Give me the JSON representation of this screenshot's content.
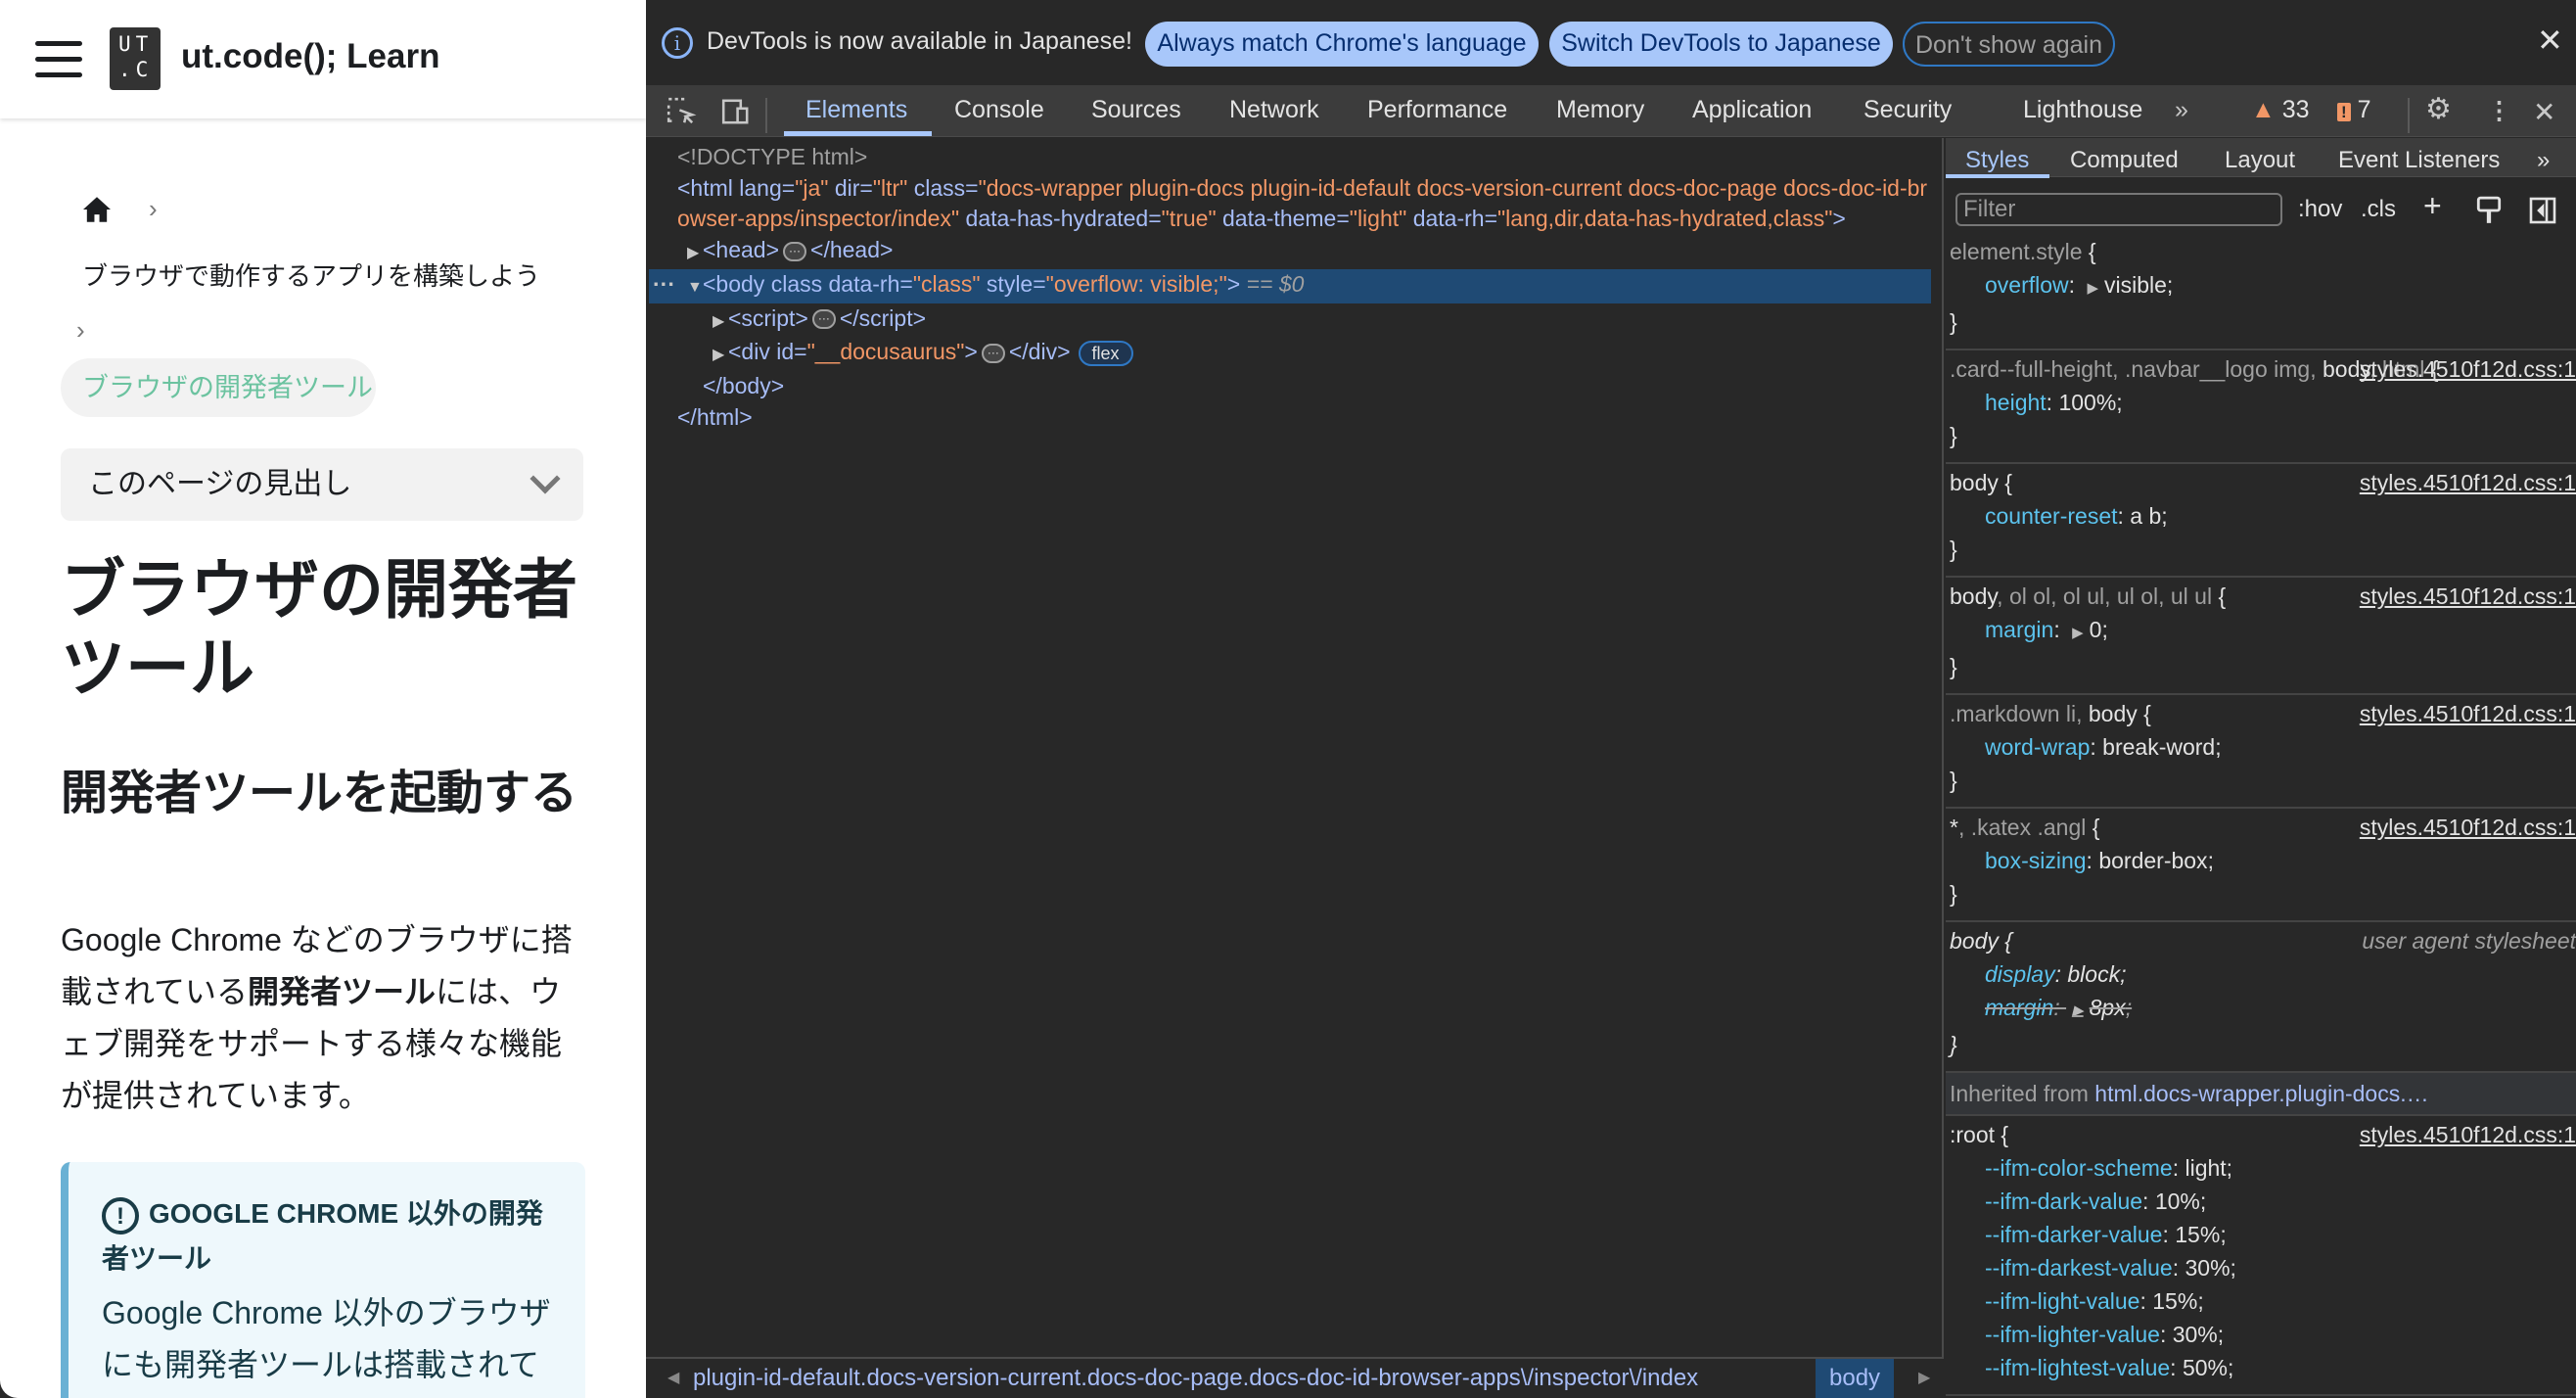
{
  "page": {
    "site_title": "ut.code(); Learn",
    "logo_text": "UT.C",
    "breadcrumb_parent": "ブラウザで動作するアプリを構築しよう",
    "breadcrumb_current": "ブラウザの開発者ツール",
    "toc_label": "このページの見出し",
    "h1": "ブラウザの開発者ツール",
    "h2": "開発者ツールを起動する",
    "para_before": "Google Chrome などのブラウザに搭載されている",
    "para_bold": "開発者ツール",
    "para_after": "には、ウェブ開発をサポートする様々な機能が提供されています。",
    "admonition_title": "GOOGLE CHROME 以外の開発者ツール",
    "admonition_body": "Google Chrome 以外のブラウザにも開発者ツールは搭載されて"
  },
  "infobar": {
    "message": "DevTools is now available in Japanese!",
    "btn_match": "Always match Chrome's language",
    "btn_switch": "Switch DevTools to Japanese",
    "btn_dismiss": "Don't show again"
  },
  "tabs": [
    "Elements",
    "Console",
    "Sources",
    "Network",
    "Performance",
    "Memory",
    "Application",
    "Security",
    "Lighthouse"
  ],
  "active_tab": "Elements",
  "counts": {
    "warnings": "33",
    "issues": "7"
  },
  "elements_tree": [
    {
      "depth": 0,
      "tokens": [
        [
          "doc",
          "<!DOCTYPE html>"
        ]
      ]
    },
    {
      "depth": 0,
      "tokens": [
        [
          "tag",
          "<html "
        ],
        [
          "attr",
          "lang="
        ],
        [
          "val",
          "\"ja\""
        ],
        [
          "attr",
          " dir="
        ],
        [
          "val",
          "\"ltr\""
        ],
        [
          "attr",
          " class="
        ],
        [
          "val",
          "\"docs-wrapper plugin-docs plugin-id-default docs-version-current docs-doc-page docs-doc-id-browser-apps/inspector/index\""
        ],
        [
          "attr",
          " data-has-hydrated="
        ],
        [
          "val",
          "\"true\""
        ],
        [
          "attr",
          " data-theme="
        ],
        [
          "val",
          "\"light\""
        ],
        [
          "attr",
          " data-rh="
        ],
        [
          "val",
          "\"lang,dir,data-has-hydrated,class\""
        ],
        [
          "tag",
          ">"
        ]
      ]
    },
    {
      "depth": 1,
      "arrow": "right",
      "tokens": [
        [
          "tag",
          "<head>"
        ],
        [
          "ell",
          ""
        ],
        [
          "tag",
          "</head>"
        ]
      ]
    },
    {
      "depth": 1,
      "arrow": "down",
      "selected": true,
      "tokens": [
        [
          "tag",
          "<body "
        ],
        [
          "attr",
          "class data-rh="
        ],
        [
          "val",
          "\"class\""
        ],
        [
          "attr",
          " style="
        ],
        [
          "val",
          "\"overflow: visible;\""
        ],
        [
          "tag",
          ">"
        ],
        [
          "dim",
          " == $0"
        ]
      ]
    },
    {
      "depth": 2,
      "arrow": "right",
      "tokens": [
        [
          "tag",
          "<script>"
        ],
        [
          "ell",
          ""
        ],
        [
          "tag",
          "</script>"
        ]
      ]
    },
    {
      "depth": 2,
      "arrow": "right",
      "tokens": [
        [
          "tag",
          "<div "
        ],
        [
          "attr",
          "id="
        ],
        [
          "val",
          "\"__docusaurus\""
        ],
        [
          "tag",
          ">"
        ],
        [
          "ell",
          ""
        ],
        [
          "tag",
          "</div>"
        ],
        [
          "badge",
          "flex"
        ]
      ]
    },
    {
      "depth": 1,
      "tokens": [
        [
          "tag",
          "</body>"
        ]
      ]
    },
    {
      "depth": 0,
      "tokens": [
        [
          "tag",
          "</html>"
        ]
      ]
    }
  ],
  "breadcrumb_bar": {
    "path": "plugin-id-default.docs-version-current.docs-doc-page.docs-doc-id-browser-apps\\/inspector\\/index",
    "current": "body"
  },
  "styles_tabs": [
    "Styles",
    "Computed",
    "Layout",
    "Event Listeners"
  ],
  "styles_toolbar": {
    "filter_placeholder": "Filter",
    "hov": ":hov",
    "cls": ".cls"
  },
  "rules": [
    {
      "selector": [
        [
          "u",
          "element.style"
        ]
      ],
      "props": [
        {
          "name": "overflow",
          "value": "visible",
          "arrow": true
        }
      ]
    },
    {
      "selector": [
        [
          "u",
          ".card--full-height, .navbar__logo img, "
        ],
        [
          "m",
          "body"
        ],
        [
          "u",
          ", html"
        ]
      ],
      "source": "styles.4510f12d.css:1",
      "props": [
        {
          "name": "height",
          "value": "100%"
        }
      ]
    },
    {
      "selector": [
        [
          "m",
          "body"
        ]
      ],
      "source": "styles.4510f12d.css:1",
      "props": [
        {
          "name": "counter-reset",
          "value": "a b"
        }
      ]
    },
    {
      "selector": [
        [
          "m",
          "body"
        ],
        [
          "u",
          ", ol ol, ol ul, ul ol, ul ul"
        ]
      ],
      "source": "styles.4510f12d.css:1",
      "props": [
        {
          "name": "margin",
          "value": "0",
          "arrow": true
        }
      ]
    },
    {
      "selector": [
        [
          "u",
          ".markdown li, "
        ],
        [
          "m",
          "body"
        ]
      ],
      "source": "styles.4510f12d.css:1",
      "props": [
        {
          "name": "word-wrap",
          "value": "break-word"
        }
      ]
    },
    {
      "selector": [
        [
          "m",
          "*"
        ],
        [
          "u",
          ", .katex .angl"
        ]
      ],
      "source": "styles.4510f12d.css:1",
      "props": [
        {
          "name": "box-sizing",
          "value": "border-box"
        }
      ]
    },
    {
      "selector": [
        [
          "m",
          "body"
        ]
      ],
      "source": "user agent stylesheet",
      "ua": true,
      "props": [
        {
          "name": "display",
          "value": "block"
        },
        {
          "name": "margin",
          "value": "8px",
          "arrow": true,
          "strike": true
        }
      ]
    }
  ],
  "inherited": {
    "label": "Inherited from",
    "link": "html.docs-wrapper.plugin-docs.…"
  },
  "root_rule": {
    "selector": [
      [
        "m",
        ":root"
      ]
    ],
    "source": "styles.4510f12d.css:1",
    "props": [
      {
        "name": "--ifm-color-scheme",
        "value": "light"
      },
      {
        "name": "--ifm-dark-value",
        "value": "10%"
      },
      {
        "name": "--ifm-darker-value",
        "value": "15%"
      },
      {
        "name": "--ifm-darkest-value",
        "value": "30%"
      },
      {
        "name": "--ifm-light-value",
        "value": "15%"
      },
      {
        "name": "--ifm-lighter-value",
        "value": "30%"
      },
      {
        "name": "--ifm-lightest-value",
        "value": "50%"
      }
    ]
  },
  "colors": {
    "accent": "#a8c7fa",
    "selected_row": "#1f4a74",
    "attr_value": "#f29766",
    "property": "#5cc3ee",
    "link_green": "#6cc3a0"
  }
}
